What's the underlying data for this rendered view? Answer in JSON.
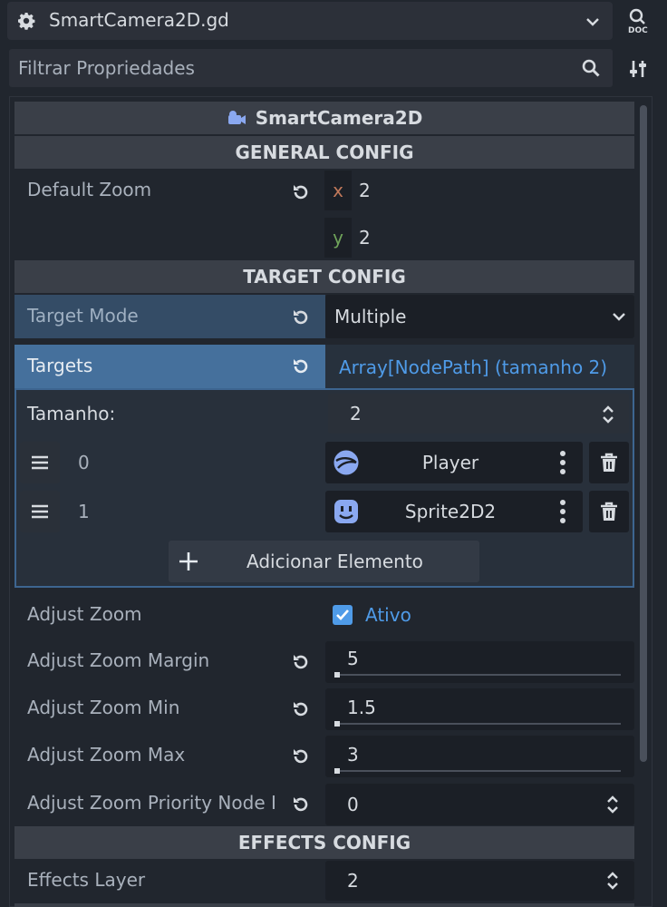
{
  "top": {
    "script_name": "SmartCamera2D.gd",
    "filter_placeholder": "Filtrar Propriedades"
  },
  "inspector": {
    "class_name": "SmartCamera2D",
    "sections": {
      "general": "GENERAL CONFIG",
      "target": "TARGET CONFIG",
      "effects": "EFFECTS CONFIG"
    },
    "default_zoom": {
      "label": "Default Zoom",
      "x_label": "x",
      "x": "2",
      "y_label": "y",
      "y": "2"
    },
    "target_mode": {
      "label": "Target Mode",
      "value": "Multiple"
    },
    "targets": {
      "label": "Targets",
      "value": "Array[NodePath] (tamanho 2)",
      "size_label": "Tamanho:",
      "size": "2",
      "items": [
        {
          "index": "0",
          "node": "Player"
        },
        {
          "index": "1",
          "node": "Sprite2D2"
        }
      ],
      "add_label": "Adicionar Elemento"
    },
    "adjust_zoom": {
      "label": "Adjust Zoom",
      "value": "Ativo",
      "checked": true
    },
    "adjust_zoom_margin": {
      "label": "Adjust Zoom Margin",
      "value": "5"
    },
    "adjust_zoom_min": {
      "label": "Adjust Zoom Min",
      "value": "1.5"
    },
    "adjust_zoom_max": {
      "label": "Adjust Zoom Max",
      "value": "3"
    },
    "adjust_zoom_priority": {
      "label": "Adjust Zoom Priority Node I",
      "value": "0"
    },
    "effects_layer": {
      "label": "Effects Layer",
      "value": "2"
    }
  },
  "colors": {
    "accent": "#4f9be8",
    "selected_row": "#3f5f82",
    "axis_x": "#c0785a",
    "axis_y": "#6fa35a"
  }
}
